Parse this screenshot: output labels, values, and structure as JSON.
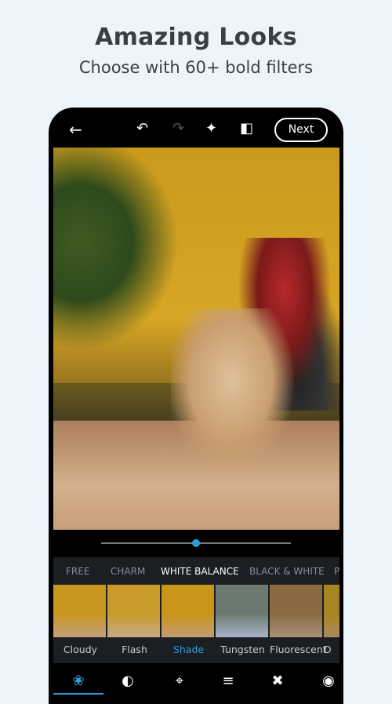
{
  "header": {
    "title": "Amazing Looks",
    "subtitle": "Choose with 60+ bold filters"
  },
  "toolbar": {
    "next_label": "Next",
    "icons": [
      "back-arrow-icon",
      "undo-icon",
      "redo-icon",
      "magic-wand-icon",
      "compare-icon"
    ]
  },
  "slider": {
    "value": 0.5,
    "accent": "#2d9cdb"
  },
  "tabs": [
    {
      "label": "FREE"
    },
    {
      "label": "CHARM"
    },
    {
      "label": "WHITE BALANCE",
      "active": true
    },
    {
      "label": "BLACK & WHITE"
    },
    {
      "label": "P"
    }
  ],
  "filters": [
    {
      "label": "Cloudy"
    },
    {
      "label": "Flash"
    },
    {
      "label": "Shade",
      "active": true
    },
    {
      "label": "Tungsten"
    },
    {
      "label": "Fluorescent"
    },
    {
      "label": "D"
    }
  ],
  "bottom_nav": [
    "looks-icon",
    "blend-icon",
    "crop-icon",
    "adjust-icon",
    "heal-icon",
    "eye-icon"
  ]
}
